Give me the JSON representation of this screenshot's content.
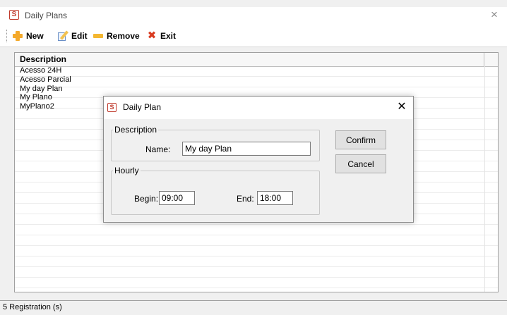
{
  "window": {
    "title": "Daily Plans",
    "icon": "app-logo-icon",
    "icon_glyph": "S",
    "close_glyph": "×"
  },
  "toolbar": {
    "new_label": "New",
    "edit_label": "Edit",
    "remove_label": "Remove",
    "exit_label": "Exit",
    "new_icon": "plus-icon",
    "edit_icon": "pencil-icon",
    "remove_icon": "minus-icon",
    "exit_icon": "red-x-icon",
    "exit_glyph": "✖"
  },
  "grid": {
    "column_header": "Description",
    "rows": [
      "Acesso 24H",
      "Acesso Parcial",
      "My day Plan",
      "My Plano",
      "MyPlano2"
    ]
  },
  "status": {
    "text": "5 Registration (s)"
  },
  "dialog": {
    "title": "Daily Plan",
    "icon_glyph": "S",
    "close_glyph": "✕",
    "description_group": "Description",
    "name_label": "Name:",
    "name_value": "My day Plan",
    "hourly_group": "Hourly",
    "begin_label": "Begin:",
    "begin_value": "09:00",
    "end_label": "End:",
    "end_value": "18:00",
    "confirm_label": "Confirm",
    "cancel_label": "Cancel"
  },
  "colors": {
    "window_bg": "#f0f0f0",
    "accent_icon": "#c0392b",
    "plus_icon": "#f4a92a",
    "exit_icon": "#d93a1f"
  }
}
